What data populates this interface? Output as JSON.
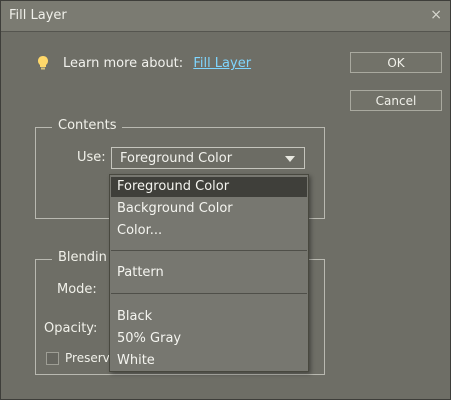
{
  "dialog": {
    "title": "Fill Layer",
    "close_icon": "close-icon",
    "learn_more_label": "Learn more about:",
    "learn_more_link": "Fill Layer",
    "ok_label": "OK",
    "cancel_label": "Cancel"
  },
  "contents": {
    "group_title": "Contents",
    "use_label": "Use:",
    "use_value": "Foreground Color",
    "dropdown_items": [
      "Foreground Color",
      "Background Color",
      "Color...",
      "Pattern",
      "Black",
      "50% Gray",
      "White"
    ]
  },
  "blending": {
    "group_title": "Blendin",
    "mode_label": "Mode:",
    "opacity_label": "Opacity:",
    "preserve_label": "Preserv"
  },
  "colors": {
    "dialog_bg": "#6e6e66",
    "link": "#7fd6ff",
    "dropdown_selected": "#3f3f3a"
  }
}
